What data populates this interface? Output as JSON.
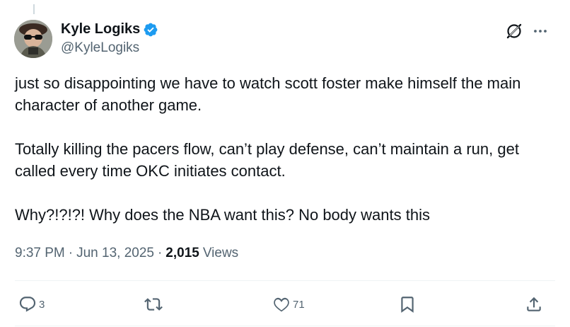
{
  "author": {
    "display_name": "Kyle Logiks",
    "handle": "@KyleLogiks",
    "verified": true,
    "avatar_icon": "profile-photo"
  },
  "tweet": {
    "paragraphs": [
      "just so disappointing we have to watch scott foster make himself the main character of another game.",
      "Totally killing the pacers flow, can’t play defense, can’t maintain a run, get called every time OKC initiates contact.",
      "Why?!?!?! Why does the NBA want this? No body wants this"
    ]
  },
  "meta": {
    "time": "9:37 PM",
    "separator": "·",
    "date": "Jun 13, 2025",
    "views_count": "2,015",
    "views_label": "Views"
  },
  "actions": {
    "reply_count": "3",
    "retweet_count": "",
    "like_count": "71"
  },
  "colors": {
    "text_primary": "#0f1419",
    "text_secondary": "#536471",
    "verified_blue": "#1d9bf0",
    "divider": "#eff3f4"
  },
  "icons": [
    "grok-icon",
    "more-icon",
    "reply-icon",
    "retweet-icon",
    "like-icon",
    "bookmark-icon",
    "share-icon",
    "verified-badge-icon"
  ]
}
